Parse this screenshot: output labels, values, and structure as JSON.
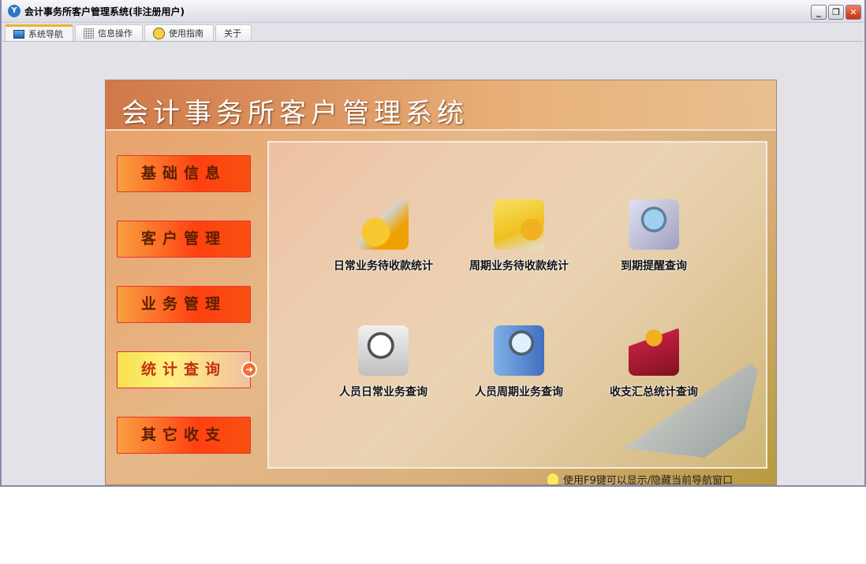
{
  "window": {
    "title": "会计事务所客户管理系统(非注册用户)",
    "logo": "Y"
  },
  "tabs": [
    {
      "label": "系统导航",
      "icon": "monitor-icon"
    },
    {
      "label": "信息操作",
      "icon": "grid-icon"
    },
    {
      "label": "使用指南",
      "icon": "help-icon"
    },
    {
      "label": "关于",
      "icon": ""
    }
  ],
  "header": {
    "title": "会计事务所客户管理系统"
  },
  "nav": [
    {
      "label": "基础信息"
    },
    {
      "label": "客户管理"
    },
    {
      "label": "业务管理"
    },
    {
      "label": "统计查询",
      "active": true
    },
    {
      "label": "其它收支"
    }
  ],
  "items": [
    {
      "label": "日常业务待收款统计",
      "icon": "coins-laptop-icon"
    },
    {
      "label": "周期业务待收款统计",
      "icon": "card-coins-icon"
    },
    {
      "label": "到期提醒查询",
      "icon": "magnifier-doc-icon"
    },
    {
      "label": "人员日常业务查询",
      "icon": "magnifier-film-icon"
    },
    {
      "label": "人员周期业务查询",
      "icon": "magnifier-book-icon"
    },
    {
      "label": "收支汇总统计查询",
      "icon": "ledger-coins-icon"
    }
  ],
  "tip": "使用F9键可以显示/隐藏当前导航窗口",
  "colors": {
    "nav": "#ff4010",
    "active_nav": "#f8e050"
  }
}
